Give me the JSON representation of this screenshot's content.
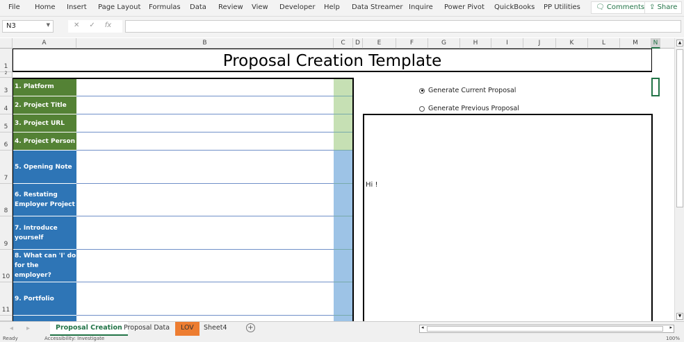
{
  "ribbon": {
    "tabs": [
      "File",
      "Home",
      "Insert",
      "Page Layout",
      "Formulas",
      "Data",
      "Review",
      "View",
      "Developer",
      "Help",
      "Data Streamer",
      "Inquire",
      "Power Pivot",
      "QuickBooks",
      "PP Utilities"
    ],
    "comments": "Comments",
    "share": "Share"
  },
  "formula_bar": {
    "name_box": "N3",
    "fx": "fx",
    "value": ""
  },
  "columns": [
    "A",
    "B",
    "C",
    "D",
    "E",
    "F",
    "G",
    "H",
    "I",
    "J",
    "K",
    "L",
    "M",
    "N"
  ],
  "rows": [
    "1",
    "2",
    "3",
    "4",
    "5",
    "6",
    "7",
    "8",
    "9",
    "10",
    "11"
  ],
  "sheet": {
    "title": "Proposal Creation Template",
    "labels": [
      "1. Platform",
      "2. Project Title",
      "3. Project URL",
      "4. Project Person",
      "5. Opening Note",
      "6. Restating Employer Project",
      "7. Introduce yourself",
      "8. What can 'I' do for the employer?",
      "9. Portfolio"
    ],
    "options": [
      {
        "label": "Generate Current Proposal",
        "selected": true
      },
      {
        "label": "Generate Previous Proposal",
        "selected": false
      }
    ],
    "output_text": "Hi !"
  },
  "colors": {
    "green": "#548235",
    "light_green": "#c6e0b4",
    "blue": "#2e75b6",
    "light_blue": "#9dc3e6",
    "orange": "#ed7d31",
    "excel_green": "#217346"
  },
  "sheet_tabs": [
    {
      "label": "Proposal Creation",
      "active": true
    },
    {
      "label": "Proposal Data"
    },
    {
      "label": "LOV",
      "color": "#ed7d31"
    },
    {
      "label": "Sheet4"
    }
  ],
  "status": {
    "ready": "Ready",
    "accessibility": "Accessibility: Investigate",
    "zoom": "100%"
  }
}
